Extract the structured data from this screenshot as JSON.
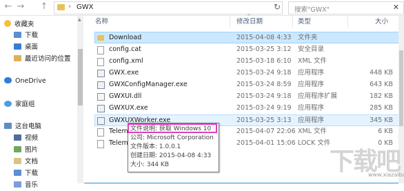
{
  "address": {
    "path": "GWX",
    "back": "←",
    "forward": "→",
    "up": "↑",
    "refresh": "↻"
  },
  "search": {
    "placeholder": "搜索\"GWX\"",
    "clear": "✕"
  },
  "nav": {
    "favorites": "收藏夹",
    "downloads": "下载",
    "desktop": "桌面",
    "recent": "最近访问的位置",
    "onedrive": "OneDrive",
    "homegroup": "家庭组",
    "thispc": "这台电脑",
    "videos": "视频",
    "pictures": "图片",
    "documents": "文档",
    "downloads2": "下载",
    "music": "音乐"
  },
  "columns": {
    "name": "名称",
    "date": "修改日期",
    "type": "类型",
    "size": "大小"
  },
  "files": [
    {
      "name": "Download",
      "date": "2015-04-08 4:33",
      "type": "文件夹",
      "size": "",
      "icon": "folder"
    },
    {
      "name": "config.cat",
      "date": "2015-03-25 3:12",
      "type": "安全目录",
      "size": "",
      "icon": "doc"
    },
    {
      "name": "config.xml",
      "date": "2015-03-18 6:10",
      "type": "XML 文件",
      "size": "",
      "icon": "doc"
    },
    {
      "name": "GWX.exe",
      "date": "2015-03-24 9:18",
      "type": "应用程序",
      "size": "448 KB",
      "icon": "exe"
    },
    {
      "name": "GWXConfigManager.exe",
      "date": "2015-03-24 8:59",
      "type": "应用程序",
      "size": "643 KB",
      "icon": "exe"
    },
    {
      "name": "GWXUI.dll",
      "date": "2015-03-24 9:18",
      "type": "应用程序扩展",
      "size": "182 KB",
      "icon": "dll"
    },
    {
      "name": "GWXUX.exe",
      "date": "2015-03-24 9:19",
      "type": "应用程序",
      "size": "285 KB",
      "icon": "exe"
    },
    {
      "name": "GWXUXWorker.exe",
      "date": "2015-03-25 3:13",
      "type": "应用程序",
      "size": "345 KB",
      "icon": "exe"
    },
    {
      "name": "Telem",
      "date": "2015-04-07 22:06",
      "type": "XML 文件",
      "size": "6 KB",
      "icon": "doc"
    },
    {
      "name": "Telem",
      "date": "2015-04-01 15:06",
      "type": "LOCK 文件",
      "size": "0 KB",
      "icon": "doc"
    }
  ],
  "tooltip": {
    "desc": "文件说明: 获取 Windows 10",
    "company": "公司: Microsoft Corporation",
    "version": "文件版本: 1.0.0.1",
    "created": "创建日期: 2015-04-08 4:33",
    "size": "大小: 344 KB"
  },
  "watermark": {
    "site": "www.xiazaiba.com"
  },
  "colors": {
    "selection": "#cce8ff",
    "highlight_border": "#e03cbe",
    "folder": "#e8c15a"
  }
}
